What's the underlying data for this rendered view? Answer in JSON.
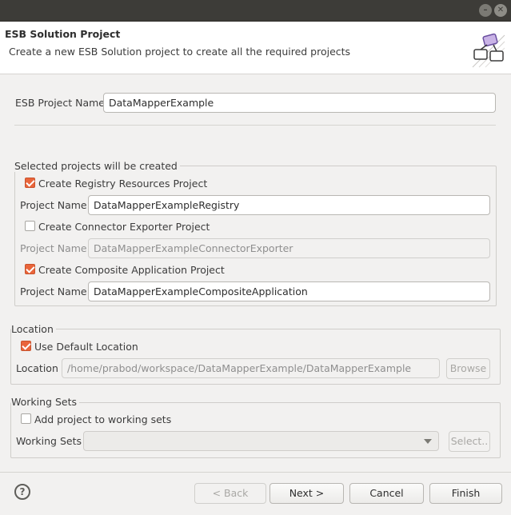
{
  "header": {
    "title": "ESB Solution Project",
    "description": "Create a new ESB Solution project to create all the required projects"
  },
  "esb_project": {
    "label": "ESB Project Name",
    "value": "DataMapperExample"
  },
  "selected_projects": {
    "legend": "Selected projects will be created",
    "registry": {
      "checkbox_label": "Create Registry Resources Project",
      "checked": true,
      "name_label": "Project Name",
      "value": "DataMapperExampleRegistry"
    },
    "connector": {
      "checkbox_label": "Create Connector Exporter Project",
      "checked": false,
      "name_label": "Project Name",
      "value": "DataMapperExampleConnectorExporter"
    },
    "composite": {
      "checkbox_label": "Create Composite Application Project",
      "checked": true,
      "name_label": "Project Name",
      "value": "DataMapperExampleCompositeApplication"
    }
  },
  "location": {
    "legend": "Location",
    "use_default_label": "Use Default Location",
    "use_default_checked": true,
    "label": "Location",
    "value": "/home/prabod/workspace/DataMapperExample/DataMapperExample",
    "browse_label": "Browse"
  },
  "working_sets": {
    "legend": "Working Sets",
    "add_label": "Add project to working sets",
    "add_checked": false,
    "label": "Working Sets",
    "value": "",
    "select_label": "Select.."
  },
  "footer": {
    "help_icon": "?",
    "back_label": "< Back",
    "next_label": "Next >",
    "cancel_label": "Cancel",
    "finish_label": "Finish"
  },
  "colors": {
    "accent": "#e9653b",
    "titlebar": "#3d3c38",
    "background": "#f2f1f0"
  }
}
